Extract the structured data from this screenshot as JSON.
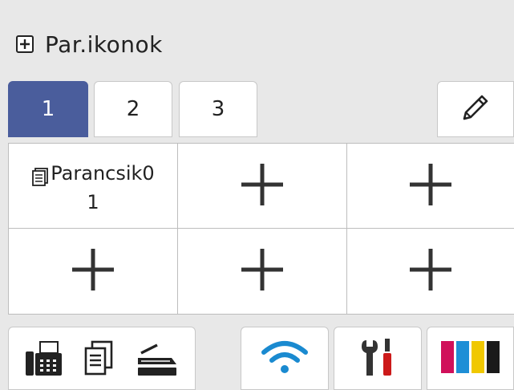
{
  "header": {
    "title": "Par.ikonok",
    "icon": "plus-box-icon"
  },
  "tabs": [
    {
      "label": "1",
      "active": true
    },
    {
      "label": "2",
      "active": false
    },
    {
      "label": "3",
      "active": false
    }
  ],
  "edit": {
    "icon": "pencil-icon"
  },
  "grid": {
    "shortcut": {
      "label_line1": "Parancsik0",
      "label_line2": "1",
      "icon": "document-icon"
    },
    "empty_icon": "plus-icon"
  },
  "bottom_bar": {
    "functions": [
      "fax-icon",
      "copy-icon",
      "scan-icon"
    ],
    "wifi_icon": "wifi-icon",
    "settings_icon": "tools-icon",
    "ink_icon": "ink-icon"
  },
  "colors": {
    "active_tab": "#4a5d9c",
    "wifi": "#1a8ad0",
    "ink_magenta": "#d0105a",
    "ink_cyan": "#1e8fd6",
    "ink_yellow": "#f0c800",
    "ink_black": "#1a1a1a",
    "tool_red": "#cc1a1a"
  }
}
